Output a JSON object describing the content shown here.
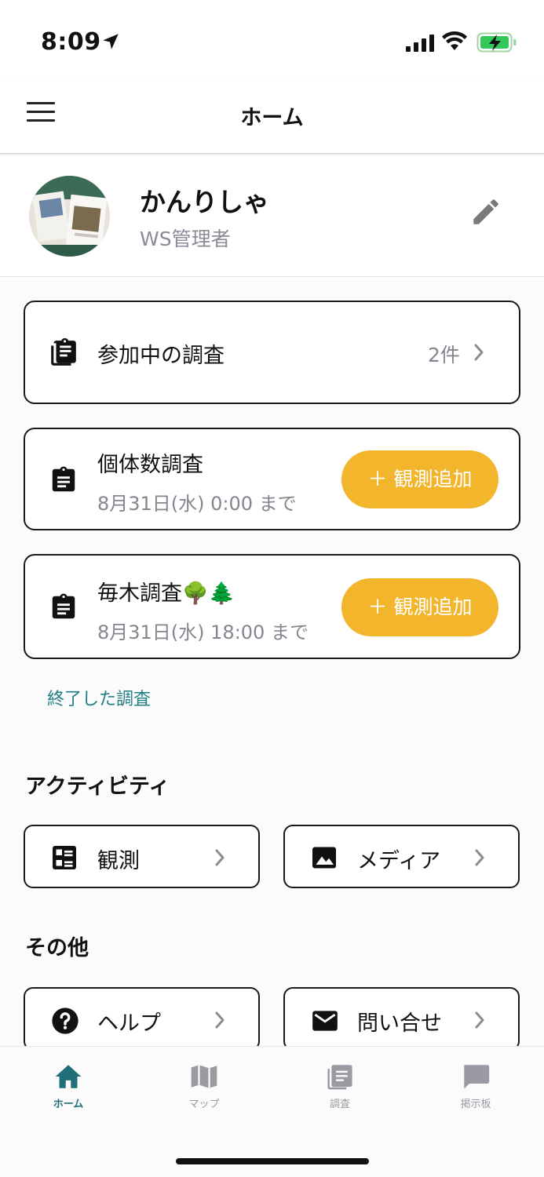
{
  "status_bar": {
    "time": "8:09"
  },
  "header": {
    "title": "ホーム"
  },
  "profile": {
    "name": "かんりしゃ",
    "role": "WS管理者"
  },
  "participating": {
    "label": "参加中の調査",
    "count": "2件"
  },
  "surveys": [
    {
      "title": "個体数調査",
      "deadline": "8月31日(水) 0:00 まで",
      "button": "＋ 観測追加"
    },
    {
      "title": "毎木調査🌳🌲",
      "deadline": "8月31日(水) 18:00 まで",
      "button": "＋ 観測追加"
    }
  ],
  "finished_link": "終了した調査",
  "activity": {
    "heading": "アクティビティ",
    "items": [
      {
        "label": "観測"
      },
      {
        "label": "メディア"
      }
    ]
  },
  "other": {
    "heading": "その他",
    "items": [
      {
        "label": "ヘルプ"
      },
      {
        "label": "問い合せ"
      }
    ]
  },
  "bottom_nav": [
    {
      "label": "ホーム",
      "icon": "home-icon",
      "active": true
    },
    {
      "label": "マップ",
      "icon": "map-icon",
      "active": false
    },
    {
      "label": "調査",
      "icon": "clipboard-list-icon",
      "active": false
    },
    {
      "label": "掲示板",
      "icon": "chat-icon",
      "active": false
    }
  ],
  "colors": {
    "accent": "#f2b52c",
    "primary": "#1f6f78",
    "link": "#1f7e86",
    "muted": "#85858f"
  }
}
